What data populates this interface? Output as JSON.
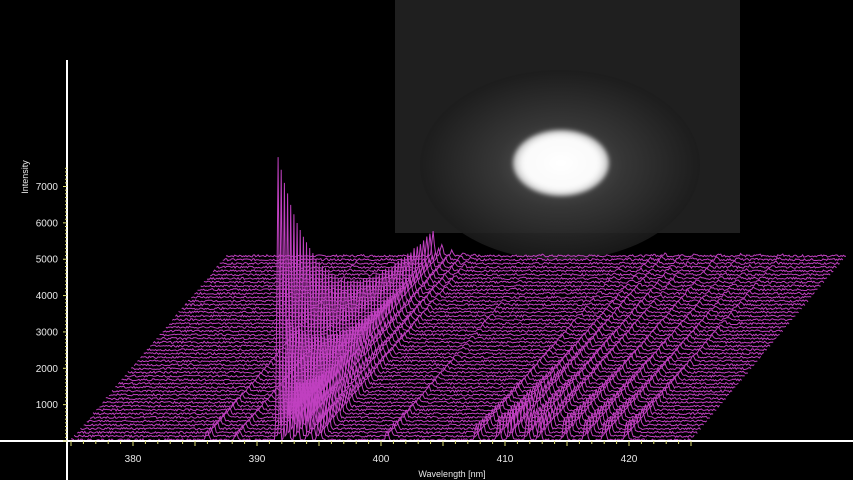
{
  "chart_data": {
    "type": "line",
    "subtype": "waterfall-3d",
    "title": "",
    "xlabel": "Wavelength [nm]",
    "ylabel": "Intensity",
    "xlim": [
      375,
      425
    ],
    "ylim": [
      0,
      7800
    ],
    "x_ticks": [
      380,
      390,
      400,
      410,
      420
    ],
    "y_ticks": [
      1000,
      2000,
      3000,
      4000,
      5000,
      6000,
      7000
    ],
    "series_count": 50,
    "line_color": "#c040c0",
    "axis_color": "#ffffff",
    "tick_color": "#e0e070",
    "background": "#000000",
    "grid": false,
    "inset_image": "emission-plume-image",
    "peaks": [
      {
        "wavelength": 391.7,
        "intensity": 7400,
        "width": 0.12
      },
      {
        "wavelength": 392.4,
        "intensity": 3200,
        "width": 0.15
      },
      {
        "wavelength": 393.2,
        "intensity": 1500,
        "width": 0.15
      },
      {
        "wavelength": 394.2,
        "intensity": 1100,
        "width": 0.15
      },
      {
        "wavelength": 395.0,
        "intensity": 700,
        "width": 0.15
      },
      {
        "wavelength": 386.0,
        "intensity": 250,
        "width": 0.15
      },
      {
        "wavelength": 388.3,
        "intensity": 200,
        "width": 0.15
      },
      {
        "wavelength": 400.5,
        "intensity": 250,
        "width": 0.15
      },
      {
        "wavelength": 407.7,
        "intensity": 400,
        "width": 0.15
      },
      {
        "wavelength": 409.5,
        "intensity": 600,
        "width": 0.15
      },
      {
        "wavelength": 410.4,
        "intensity": 750,
        "width": 0.15
      },
      {
        "wavelength": 411.8,
        "intensity": 650,
        "width": 0.15
      },
      {
        "wavelength": 412.8,
        "intensity": 550,
        "width": 0.15
      },
      {
        "wavelength": 414.8,
        "intensity": 600,
        "width": 0.15
      },
      {
        "wavelength": 416.5,
        "intensity": 550,
        "width": 0.15
      },
      {
        "wavelength": 418.0,
        "intensity": 500,
        "width": 0.15
      },
      {
        "wavelength": 419.8,
        "intensity": 450,
        "width": 0.15
      }
    ]
  }
}
